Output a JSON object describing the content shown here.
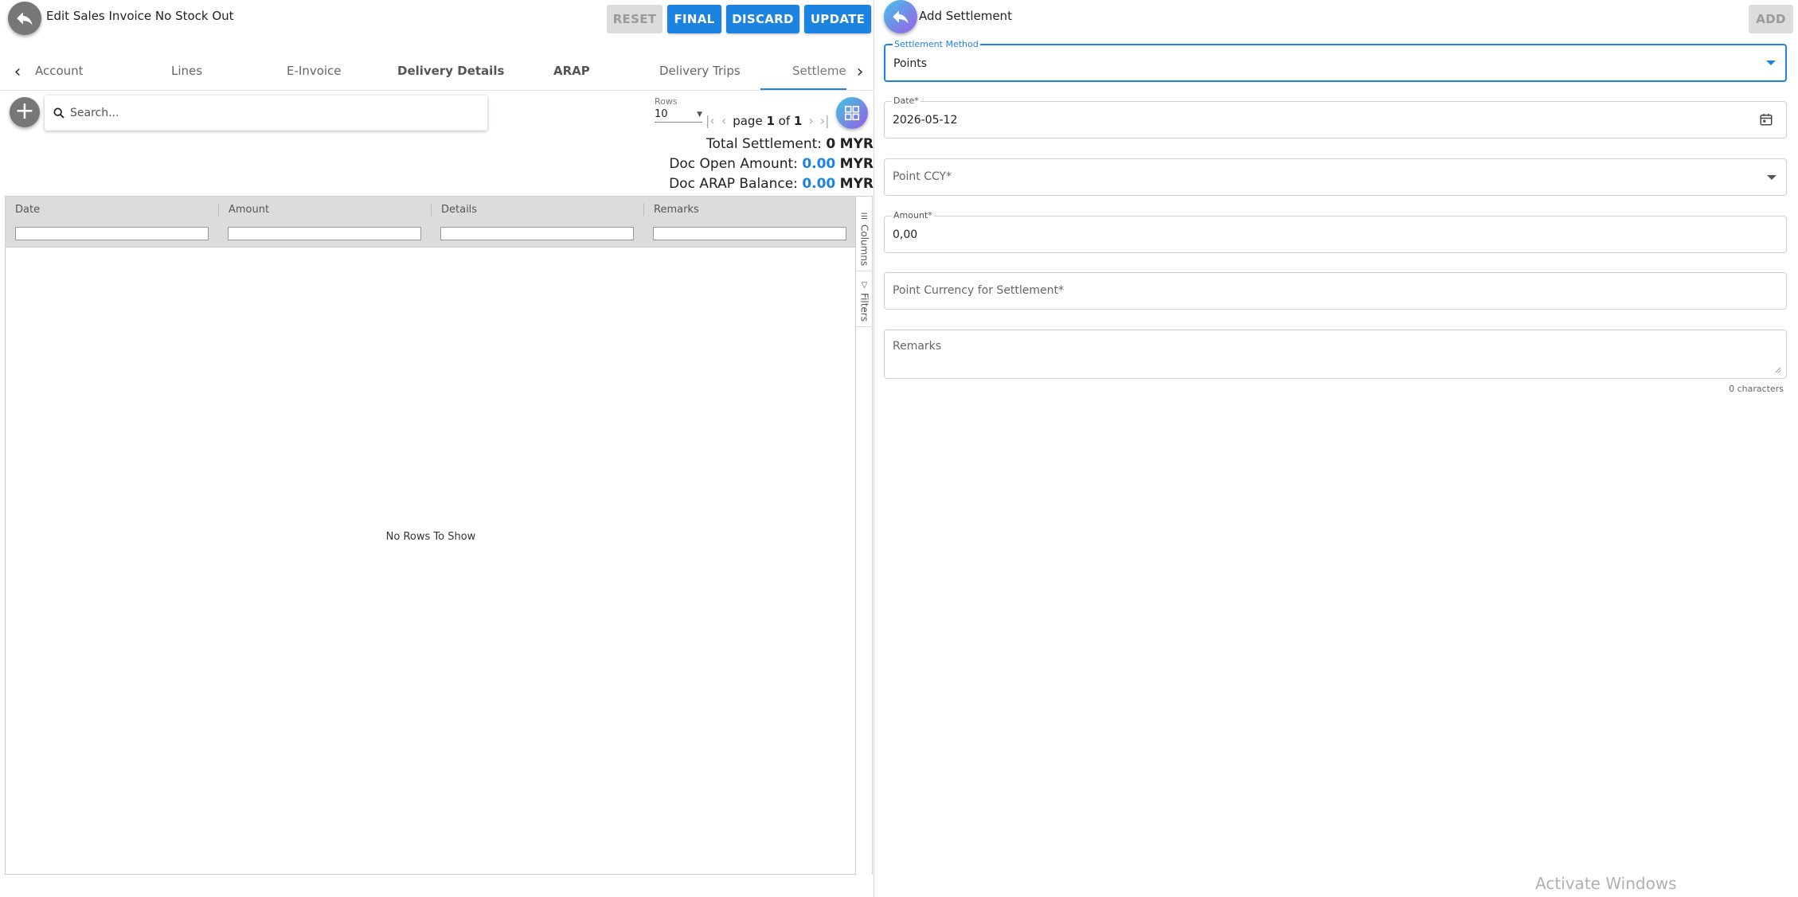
{
  "left": {
    "title": "Edit Sales Invoice No Stock Out",
    "buttons": {
      "reset": "RESET",
      "final": "FINAL",
      "discard": "DISCARD",
      "update": "UPDATE"
    },
    "tabs": [
      "Account",
      "Lines",
      "E-Invoice",
      "Delivery Details",
      "ARAP",
      "Delivery Trips",
      "Settlemen"
    ],
    "search": {
      "placeholder": "Search..."
    },
    "pager": {
      "rows_label": "Rows",
      "rows_value": "10",
      "page_word": "page",
      "page": "1",
      "of_word": "of",
      "total_pages": "1"
    },
    "totals": {
      "total_settlement_label": "Total Settlement:",
      "total_settlement_value": "0",
      "total_settlement_ccy": "MYR",
      "doc_open_label": "Doc Open Amount:",
      "doc_open_value": "0.00",
      "doc_open_ccy": "MYR",
      "doc_arap_label": "Doc ARAP Balance:",
      "doc_arap_value": "0.00",
      "doc_arap_ccy": "MYR"
    },
    "grid": {
      "columns": [
        "Date",
        "Amount",
        "Details",
        "Remarks"
      ],
      "side_tabs": {
        "columns": "Columns",
        "filters": "Filters"
      },
      "empty_text": "No Rows To Show"
    }
  },
  "right": {
    "title": "Add Settlement",
    "add_button": "ADD",
    "fields": {
      "settlement_method": {
        "label": "Settlement Method",
        "value": "Points"
      },
      "date": {
        "label": "Date*",
        "value": "2026-05-12"
      },
      "point_ccy": {
        "placeholder": "Point CCY*"
      },
      "amount": {
        "label": "Amount*",
        "value": "0,00"
      },
      "point_currency": {
        "placeholder": "Point Currency for Settlement*"
      },
      "remarks": {
        "placeholder": "Remarks",
        "char_count": "0 characters"
      }
    }
  },
  "watermark": "Activate Windows",
  "colors": {
    "accent": "#1d83e0",
    "disabled": "#dcdcdc",
    "grey_button": "#777777"
  }
}
